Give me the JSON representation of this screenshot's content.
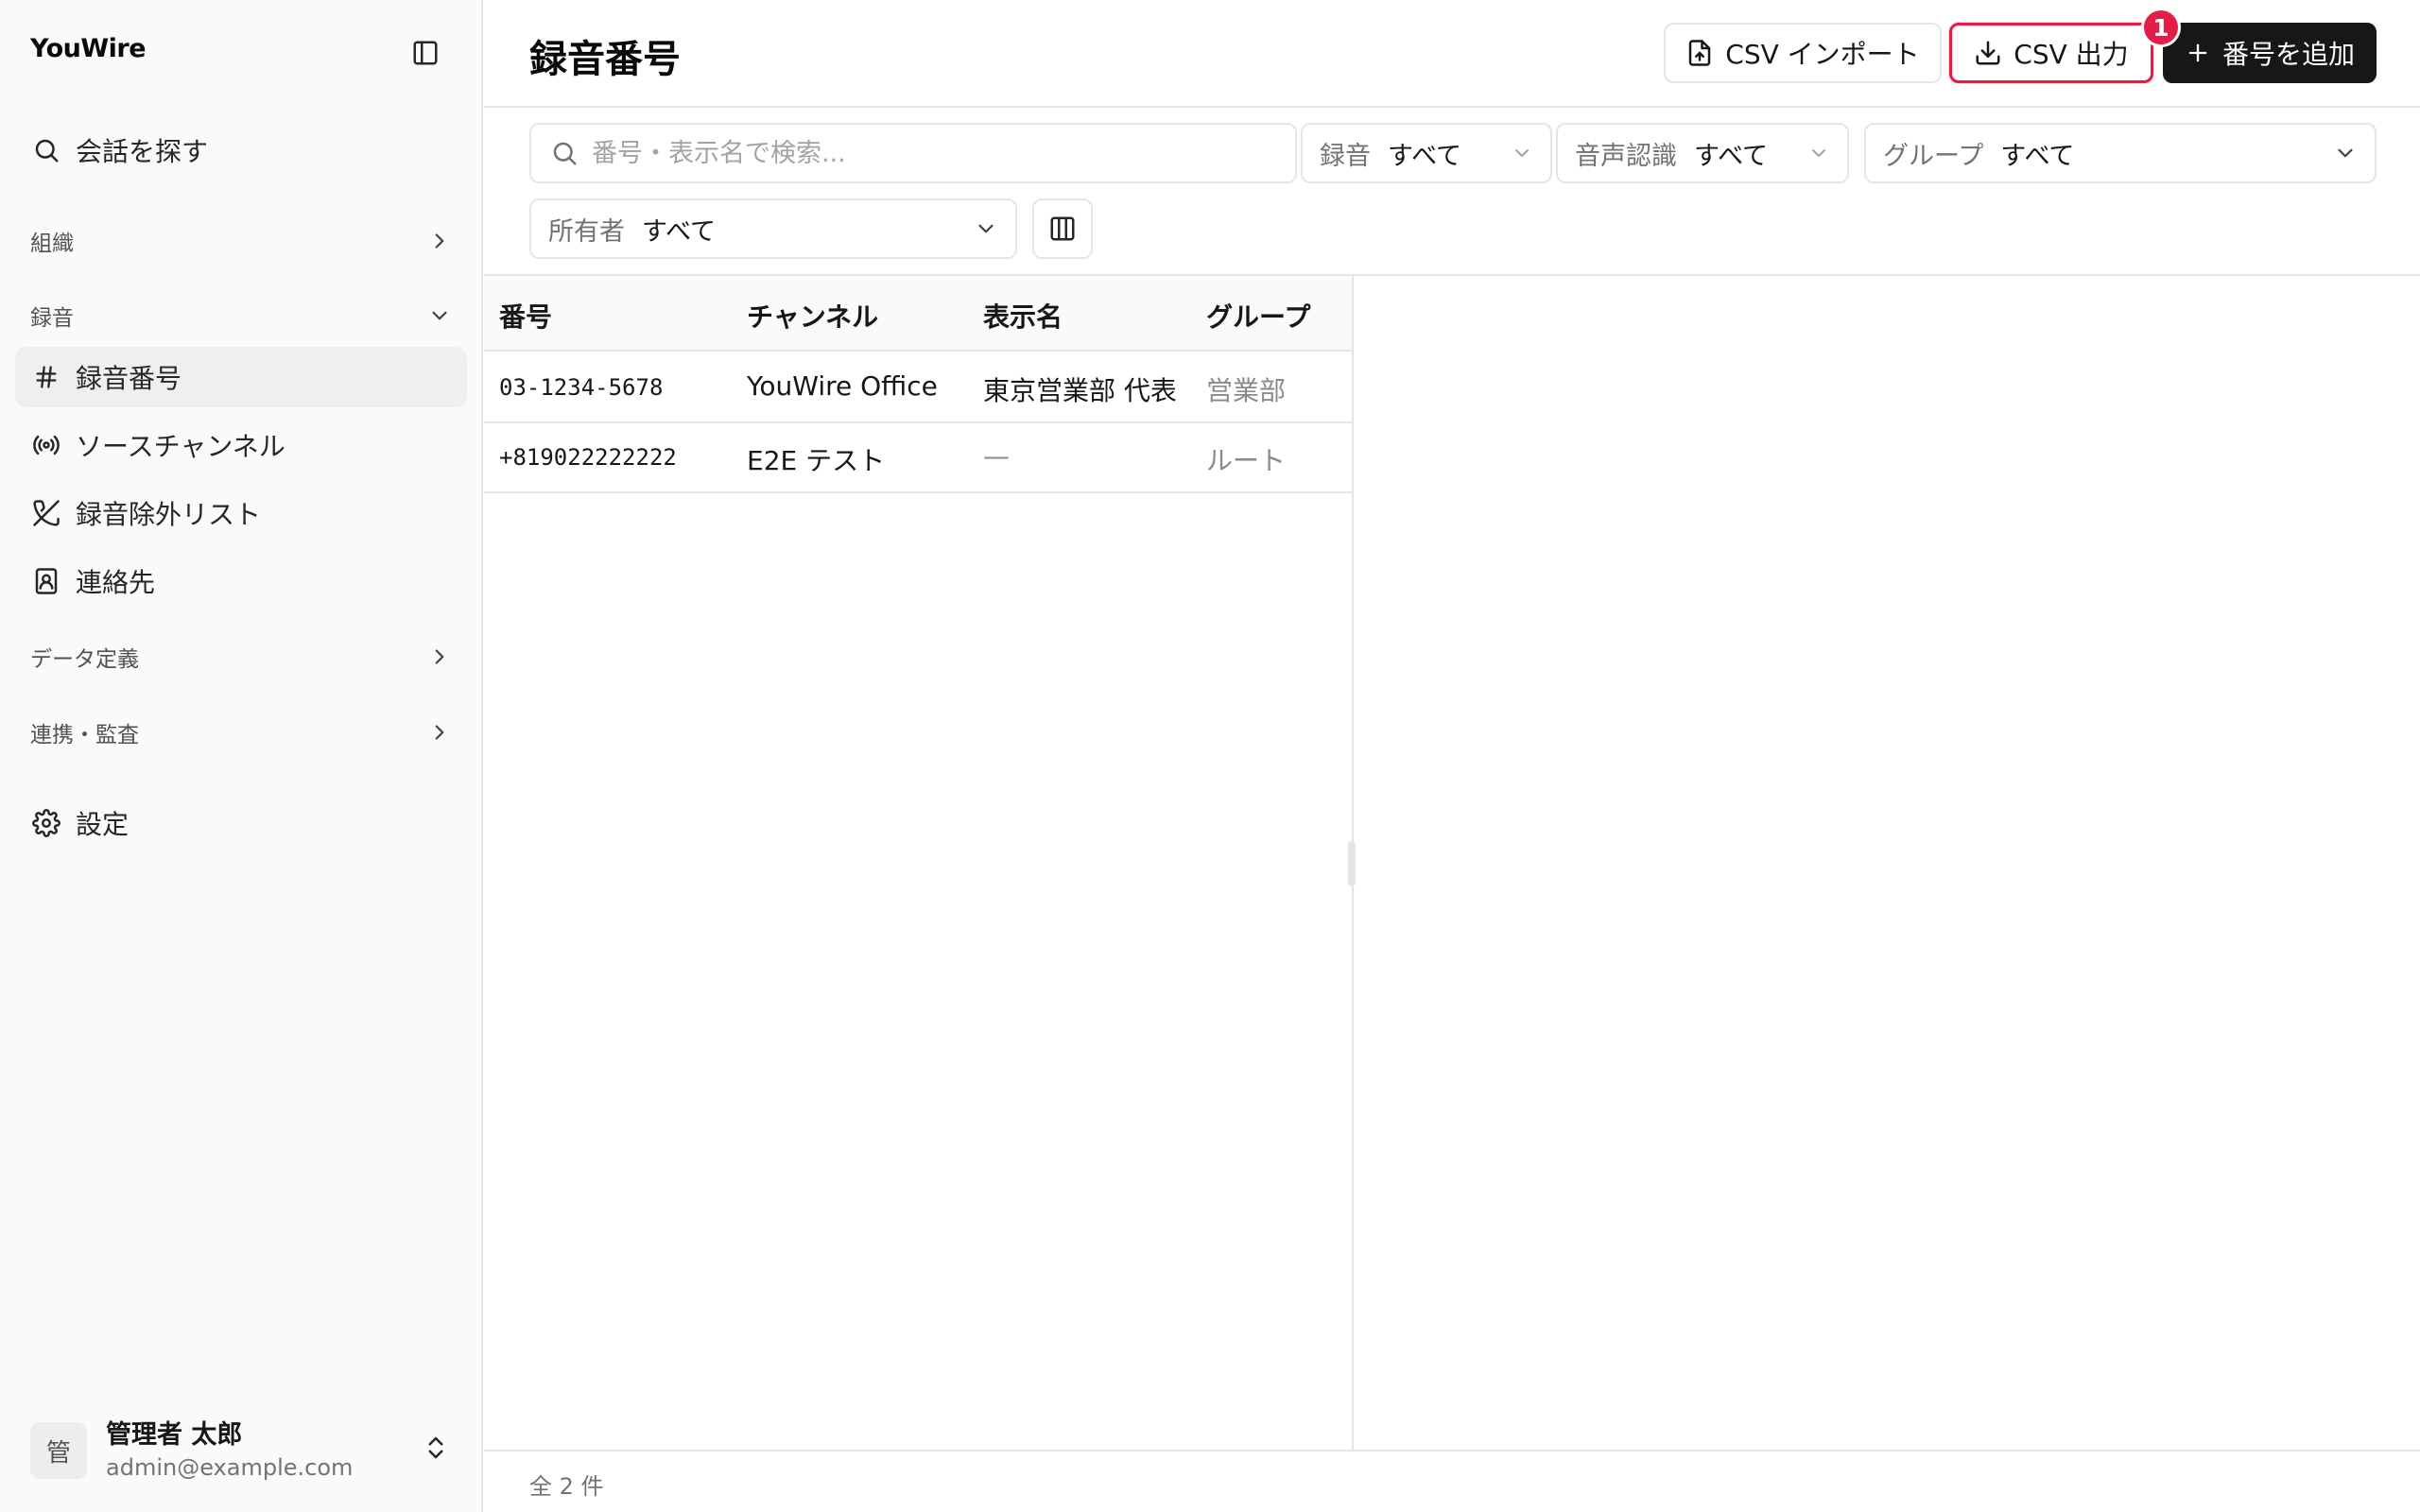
{
  "app": {
    "brand": "YouWire"
  },
  "sidebar": {
    "search_label": "会話を探す",
    "groups": {
      "organization": "組織",
      "recording": "録音",
      "data_definition": "データ定義",
      "integration": "連携・監査"
    },
    "recording_items": [
      {
        "label": "録音番号",
        "icon": "hash-icon",
        "active": true
      },
      {
        "label": "ソースチャンネル",
        "icon": "radio-icon"
      },
      {
        "label": "録音除外リスト",
        "icon": "phone-off-icon"
      },
      {
        "label": "連絡先",
        "icon": "contact-book-icon"
      }
    ],
    "settings_label": "設定",
    "user": {
      "initial": "管",
      "name": "管理者 太郎",
      "email": "admin@example.com"
    }
  },
  "header": {
    "title": "録音番号",
    "import_label": "CSV インポート",
    "export_label": "CSV 出力",
    "add_label": "番号を追加",
    "badge": "1"
  },
  "filters": {
    "search_placeholder": "番号・表示名で検索...",
    "recording": {
      "label": "録音",
      "value": "すべて"
    },
    "asr": {
      "label": "音声認識",
      "value": "すべて"
    },
    "group": {
      "label": "グループ",
      "value": "すべて"
    },
    "owner": {
      "label": "所有者",
      "value": "すべて"
    }
  },
  "table": {
    "columns": [
      "番号",
      "チャンネル",
      "表示名",
      "グループ"
    ],
    "rows": [
      [
        "03-1234-5678",
        "YouWire Office",
        "東京営業部 代表",
        "営業部"
      ],
      [
        "+819022222222",
        "E2E テスト",
        "—",
        "ルート"
      ]
    ]
  },
  "footer": {
    "count": "全 2 件"
  },
  "colors": {
    "accent_red": "#e11d48",
    "primary_dark": "#171717",
    "sidebar_bg": "#fafafa",
    "border": "#e5e5e5"
  }
}
